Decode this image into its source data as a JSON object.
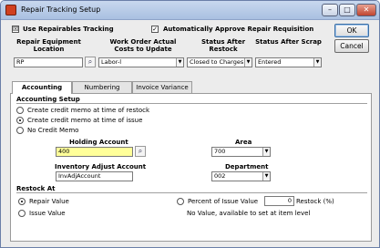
{
  "window": {
    "title": "Repair Tracking Setup"
  },
  "window_buttons": {
    "minimize": "–",
    "maximize": "□",
    "close": "✕"
  },
  "options": {
    "use_repairables": {
      "label": "Use Repairables Tracking",
      "checked": "☒"
    },
    "auto_approve": {
      "label": "Automatically Approve Repair Requisition",
      "checked": "✓"
    }
  },
  "columns": {
    "repair_location": {
      "header": "Repair Equipment Location",
      "value": "RP"
    },
    "work_order_costs": {
      "header": "Work Order Actual Costs to Update",
      "value": "Labor-l"
    },
    "status_after_restock": {
      "header": "Status After Restock",
      "value": "Closed to Charges"
    },
    "status_after_scrap": {
      "header": "Status After Scrap",
      "value": "Entered"
    }
  },
  "buttons": {
    "ok": "OK",
    "cancel": "Cancel"
  },
  "tabs": [
    {
      "label": "Accounting",
      "active": true
    },
    {
      "label": "Numbering",
      "active": false
    },
    {
      "label": "Invoice Variance",
      "active": false
    }
  ],
  "accounting": {
    "setup_label": "Accounting Setup",
    "credit_options": [
      {
        "label": "Create credit memo at time of restock",
        "selected": false
      },
      {
        "label": "Create credit memo at time of issue",
        "selected": true
      },
      {
        "label": "No Credit Memo",
        "selected": false
      }
    ],
    "holding_account": {
      "label": "Holding Account",
      "value": "400"
    },
    "area": {
      "label": "Area",
      "value": "700"
    },
    "inventory_adjust_account": {
      "label": "Inventory Adjust Account",
      "value": "InvAdjAccount"
    },
    "department": {
      "label": "Department",
      "value": "002"
    }
  },
  "restock": {
    "label": "Restock At",
    "repair_value": {
      "label": "Repair Value",
      "selected": true
    },
    "issue_value": {
      "label": "Issue Value",
      "selected": false
    },
    "percent_issue_value": {
      "label": "Percent of Issue Value",
      "selected": false
    },
    "restock_percent": {
      "value": "0",
      "label": "Restock (%)"
    },
    "note": "No Value, available to set at item level"
  },
  "colors": {
    "title_bar": "#b4c8e6",
    "highlight_field": "#ffff99",
    "window_bg": "#ececec"
  }
}
